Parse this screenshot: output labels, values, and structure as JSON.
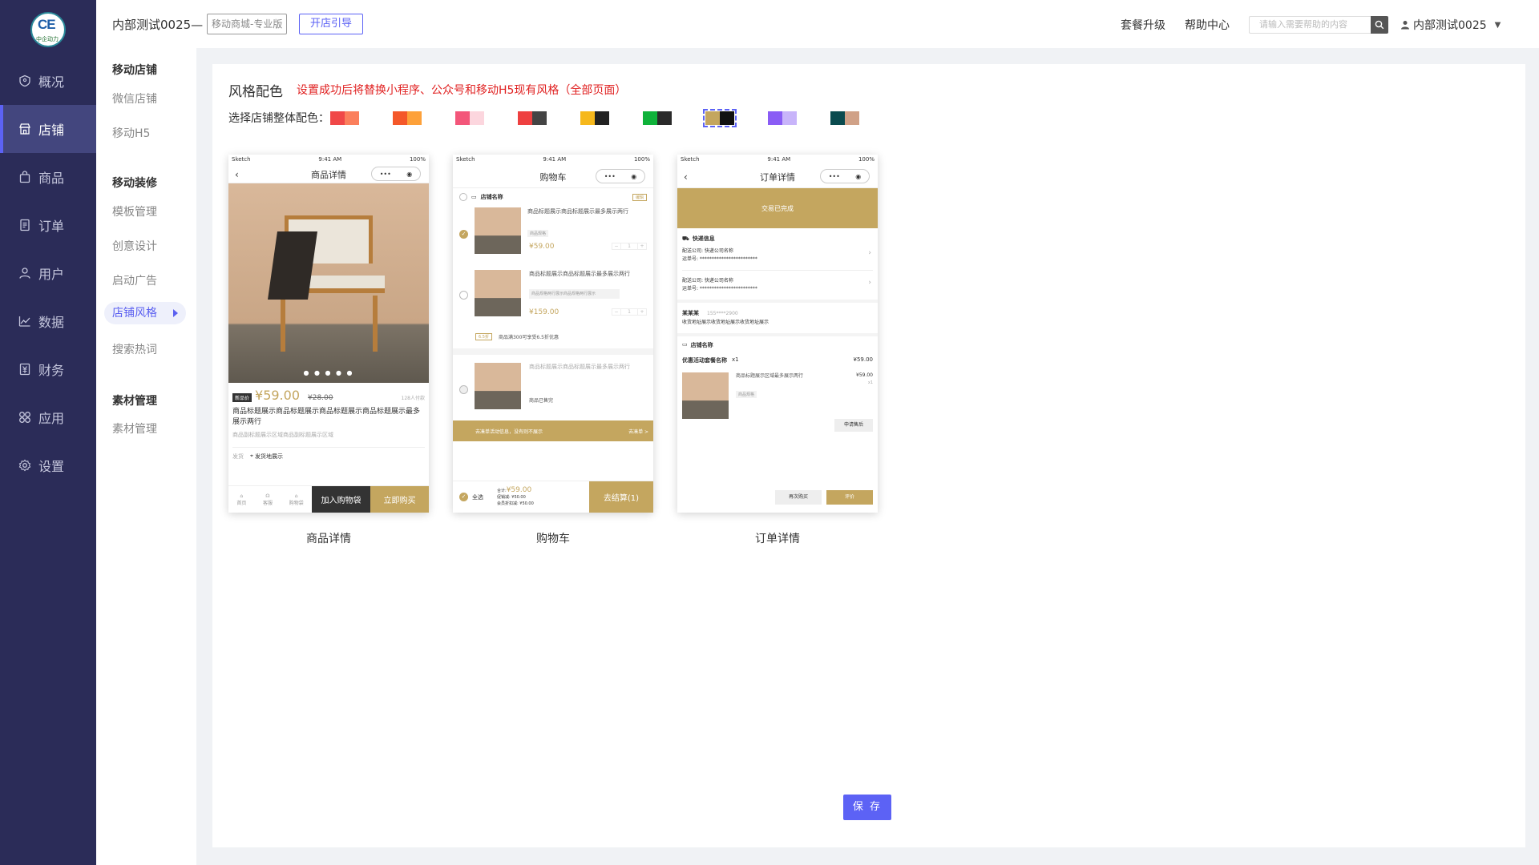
{
  "brand": {
    "logo_text": "CE",
    "logo_sub": "中企动力"
  },
  "nav": [
    {
      "label": "概况",
      "icon": "dashboard-icon"
    },
    {
      "label": "店铺",
      "icon": "store-icon",
      "active": true
    },
    {
      "label": "商品",
      "icon": "bag-icon"
    },
    {
      "label": "订单",
      "icon": "order-icon"
    },
    {
      "label": "用户",
      "icon": "user-icon"
    },
    {
      "label": "数据",
      "icon": "chart-icon"
    },
    {
      "label": "财务",
      "icon": "finance-icon"
    },
    {
      "label": "应用",
      "icon": "apps-icon"
    },
    {
      "label": "设置",
      "icon": "settings-icon"
    }
  ],
  "subnav": {
    "group1": {
      "title": "移动店铺",
      "items": [
        "微信店铺",
        "移动H5"
      ]
    },
    "group2": {
      "title": "移动装修",
      "items": [
        "模板管理",
        "创意设计",
        "启动广告",
        "店铺风格",
        "搜索热词"
      ]
    },
    "group3": {
      "title": "素材管理",
      "items": [
        "素材管理"
      ]
    }
  },
  "topbar": {
    "shop_name": "内部测试0025—",
    "edition": "移动商城-专业版",
    "guide_button": "开店引导",
    "upgrade": "套餐升级",
    "help": "帮助中心",
    "search_placeholder": "请输入需要帮助的内容",
    "user": "内部测试0025"
  },
  "style": {
    "title": "风格配色",
    "note": "设置成功后将替换小程序、公众号和移动H5现有风格（全部页面）",
    "pick_label": "选择店铺整体配色：",
    "swatches": [
      [
        "#f04848",
        "#fb7f5c"
      ],
      [
        "#f4582a",
        "#fda13a"
      ],
      [
        "#f3567a",
        "#fcd6de"
      ],
      [
        "#ee4040",
        "#444444"
      ],
      [
        "#f6b81c",
        "#222222"
      ],
      [
        "#0fb23a",
        "#2a2a2a"
      ],
      [
        "#c4a65f",
        "#111111"
      ],
      [
        "#8a5cf5",
        "#c8b4fa"
      ],
      [
        "#0a4b4f",
        "#d0a187"
      ]
    ],
    "selected_index": 6
  },
  "preview": {
    "status_left": "Sketch",
    "status_time": "9:41 AM",
    "status_right": "100%",
    "product": {
      "nav_title": "商品详情",
      "badge": "新品价",
      "price": "¥59.00",
      "old_price": "¥28.00",
      "sold": "128人付款",
      "title": "商品标题展示商品标题展示商品标题展示商品标题展示最多展示两行",
      "subtitle": "商品副标题展示区域商品副标题展示区域",
      "ship_label": "发货",
      "ship_value": "发货地展示",
      "tab_home": "首页",
      "tab_service": "客服",
      "tab_cart": "购物袋",
      "add_cart": "加入购物袋",
      "buy_now": "立即购买",
      "label": "商品详情"
    },
    "cart": {
      "nav_title": "购物车",
      "store": "店铺名称",
      "edit": "编辑",
      "item_title": "商品标题展示商品标题展示最多展示两行",
      "spec": "商品规格",
      "spec2": "商品规格两行展示商品规格两行展示",
      "price1": "¥59.00",
      "price2": "¥159.00",
      "qty": "1",
      "promo_tag": "6.5折",
      "promo": "商品满300可享受6.5折优惠",
      "sold_out": "商品已售完",
      "banner": "去凑单活动信息，没有则不展示",
      "banner_link": "去凑单 >",
      "select_all": "全选",
      "total_label": "合计:",
      "total": "¥59.00",
      "discount1": "促销减: ¥50.00",
      "discount2": "会员折扣减: ¥50.00",
      "checkout": "去结算(1)",
      "label": "购物车"
    },
    "order": {
      "nav_title": "订单详情",
      "status": "交易已完成",
      "express_title": "快递信息",
      "company1": "配送公司: 快递公司名称",
      "tracking1": "运单号: ************************",
      "company2": "配送公司: 快递公司名称",
      "tracking2": "运单号: ************************",
      "receiver": "某某某",
      "phone": "155****2900",
      "address": "收货地址展示收货地址展示收货地址展示",
      "store": "店铺名称",
      "bundle": "优惠活动套餐名称",
      "bundle_qty": "x1",
      "bundle_price": "¥59.00",
      "item_title": "商品标题展示区域最多展示两行",
      "item_price": "¥59.00",
      "item_qty": "x1",
      "spec": "商品规格",
      "refund": "申请售后",
      "rebuy": "再次购买",
      "review": "评价",
      "label": "订单详情"
    }
  },
  "save_button": "保 存"
}
